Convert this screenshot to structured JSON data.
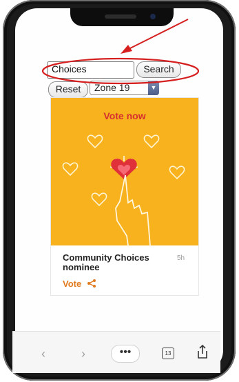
{
  "search": {
    "value": "Choices",
    "button_label": "Search"
  },
  "filters": {
    "reset_label": "Reset",
    "zone_selected": "Zone 19"
  },
  "card": {
    "banner_text": "Vote now",
    "title": "Community Choices nominee",
    "time": "5h",
    "vote_label": "Vote"
  },
  "browser": {
    "back_icon": "‹",
    "forward_icon": "›",
    "more_label": "•••",
    "tabs_count": "13"
  },
  "colors": {
    "art_bg": "#f7b21e",
    "accent": "#e07a1f",
    "annotation": "#d61f1f"
  }
}
